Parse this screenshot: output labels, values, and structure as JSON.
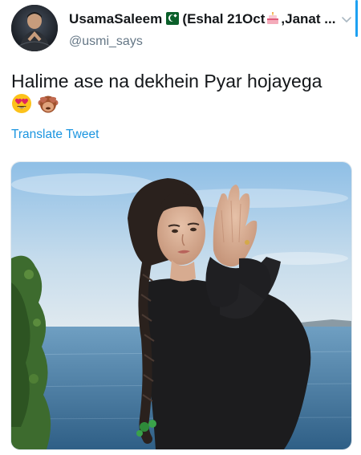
{
  "user": {
    "display_name": "UsamaSaleem",
    "name_suffix_part1": "(Eshal 21Oct",
    "name_suffix_part2": ",Janat ...",
    "handle": "@usmi_says"
  },
  "tweet": {
    "text": "Halime ase na dekhein Pyar hojayega",
    "emojis": [
      "heart-eyes-emoji",
      "see-no-evil-monkey-emoji"
    ],
    "translate_label": "Translate Tweet"
  },
  "icons": {
    "flag": "pakistan-flag-icon",
    "cake": "birthday-cake-icon",
    "menu": "chevron-down-icon"
  },
  "colors": {
    "link": "#1b95e0",
    "handle": "#657786",
    "text": "#14171a"
  }
}
